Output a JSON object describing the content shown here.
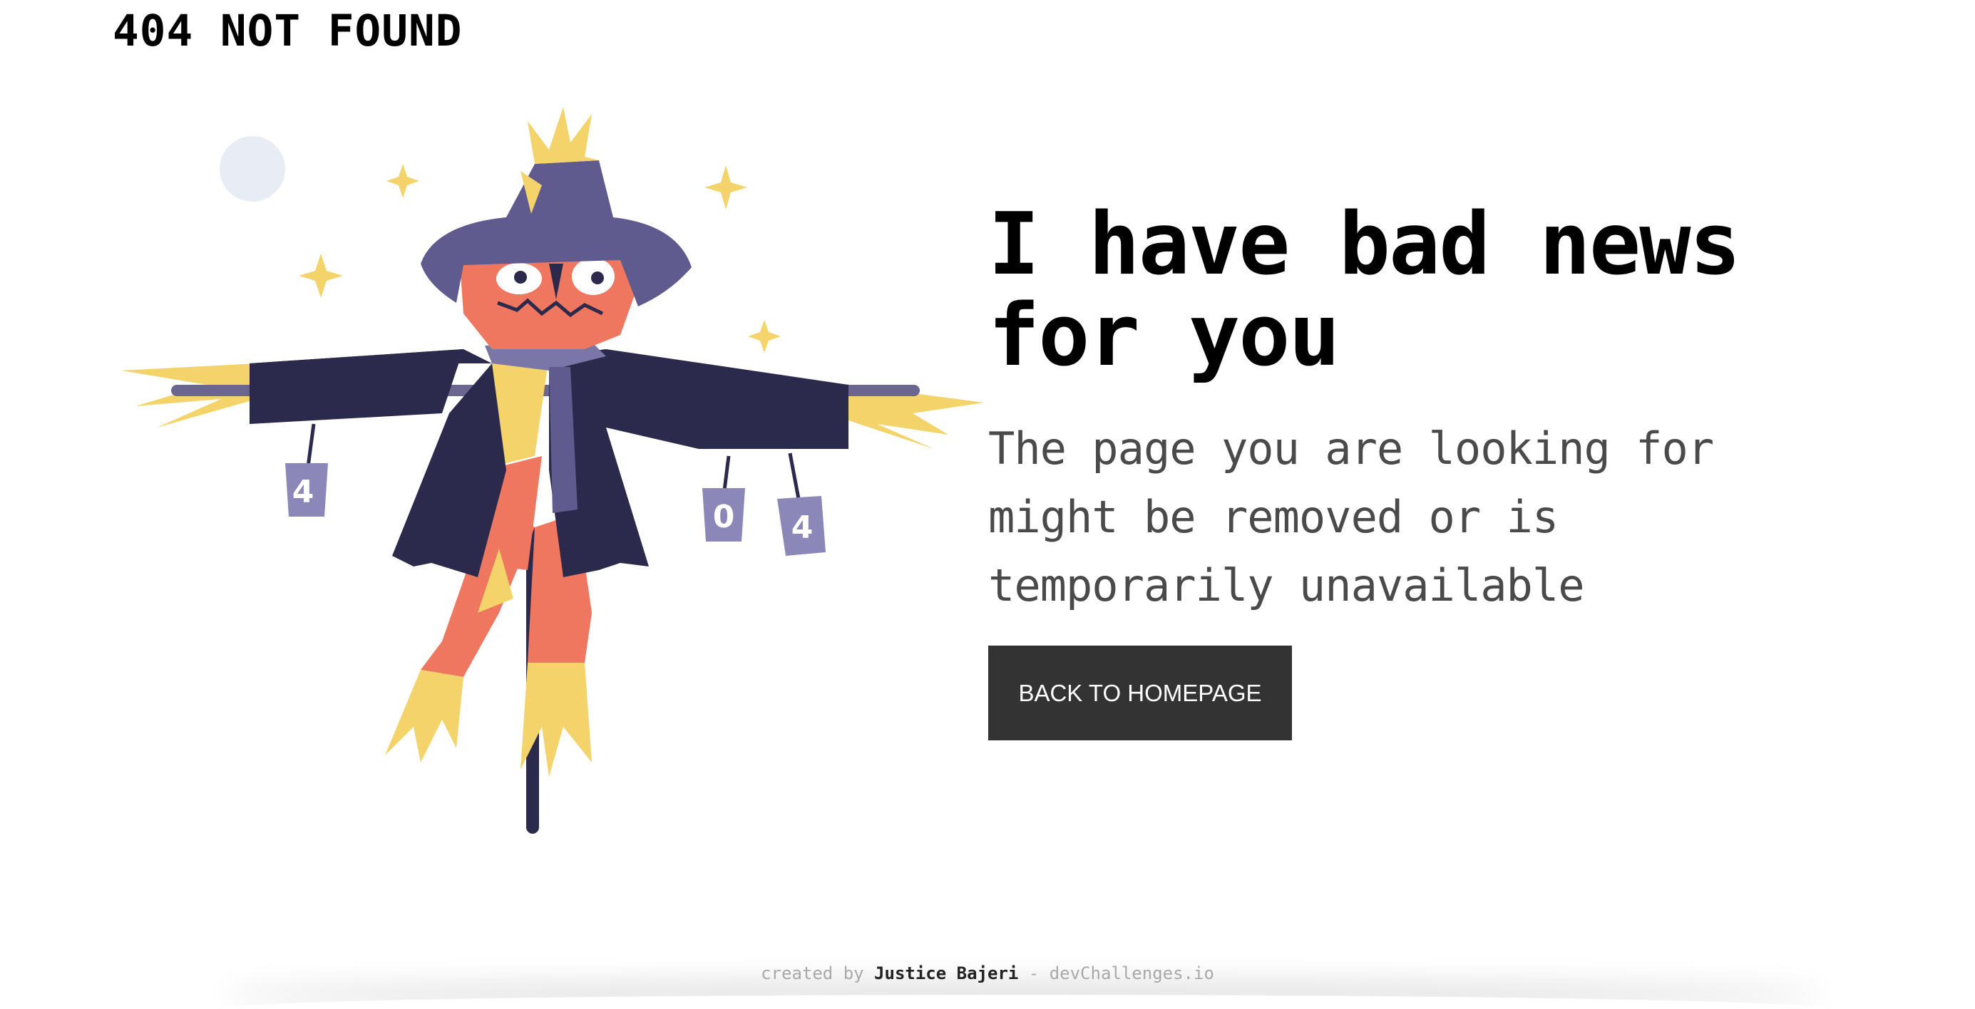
{
  "header": {
    "brand": "404 NOT FOUND"
  },
  "illustration": {
    "icon": "scarecrow-illustration",
    "cans": [
      "4",
      "0",
      "4"
    ]
  },
  "main": {
    "headline": "I have bad news for you",
    "subtext": "The page you are looking for might be removed or is temporarily unavailable",
    "button_label": "BACK TO HOMEPAGE"
  },
  "footer": {
    "prefix": "created by",
    "author": "Justice Bajeri",
    "separator": "-",
    "site": "devChallenges.io"
  },
  "colors": {
    "button_bg": "#333333",
    "coat": "#2b2a4c",
    "hat": "#5f5b8f",
    "straw": "#f5d36b",
    "skin": "#ef765f",
    "moon": "#e8ecf5"
  }
}
